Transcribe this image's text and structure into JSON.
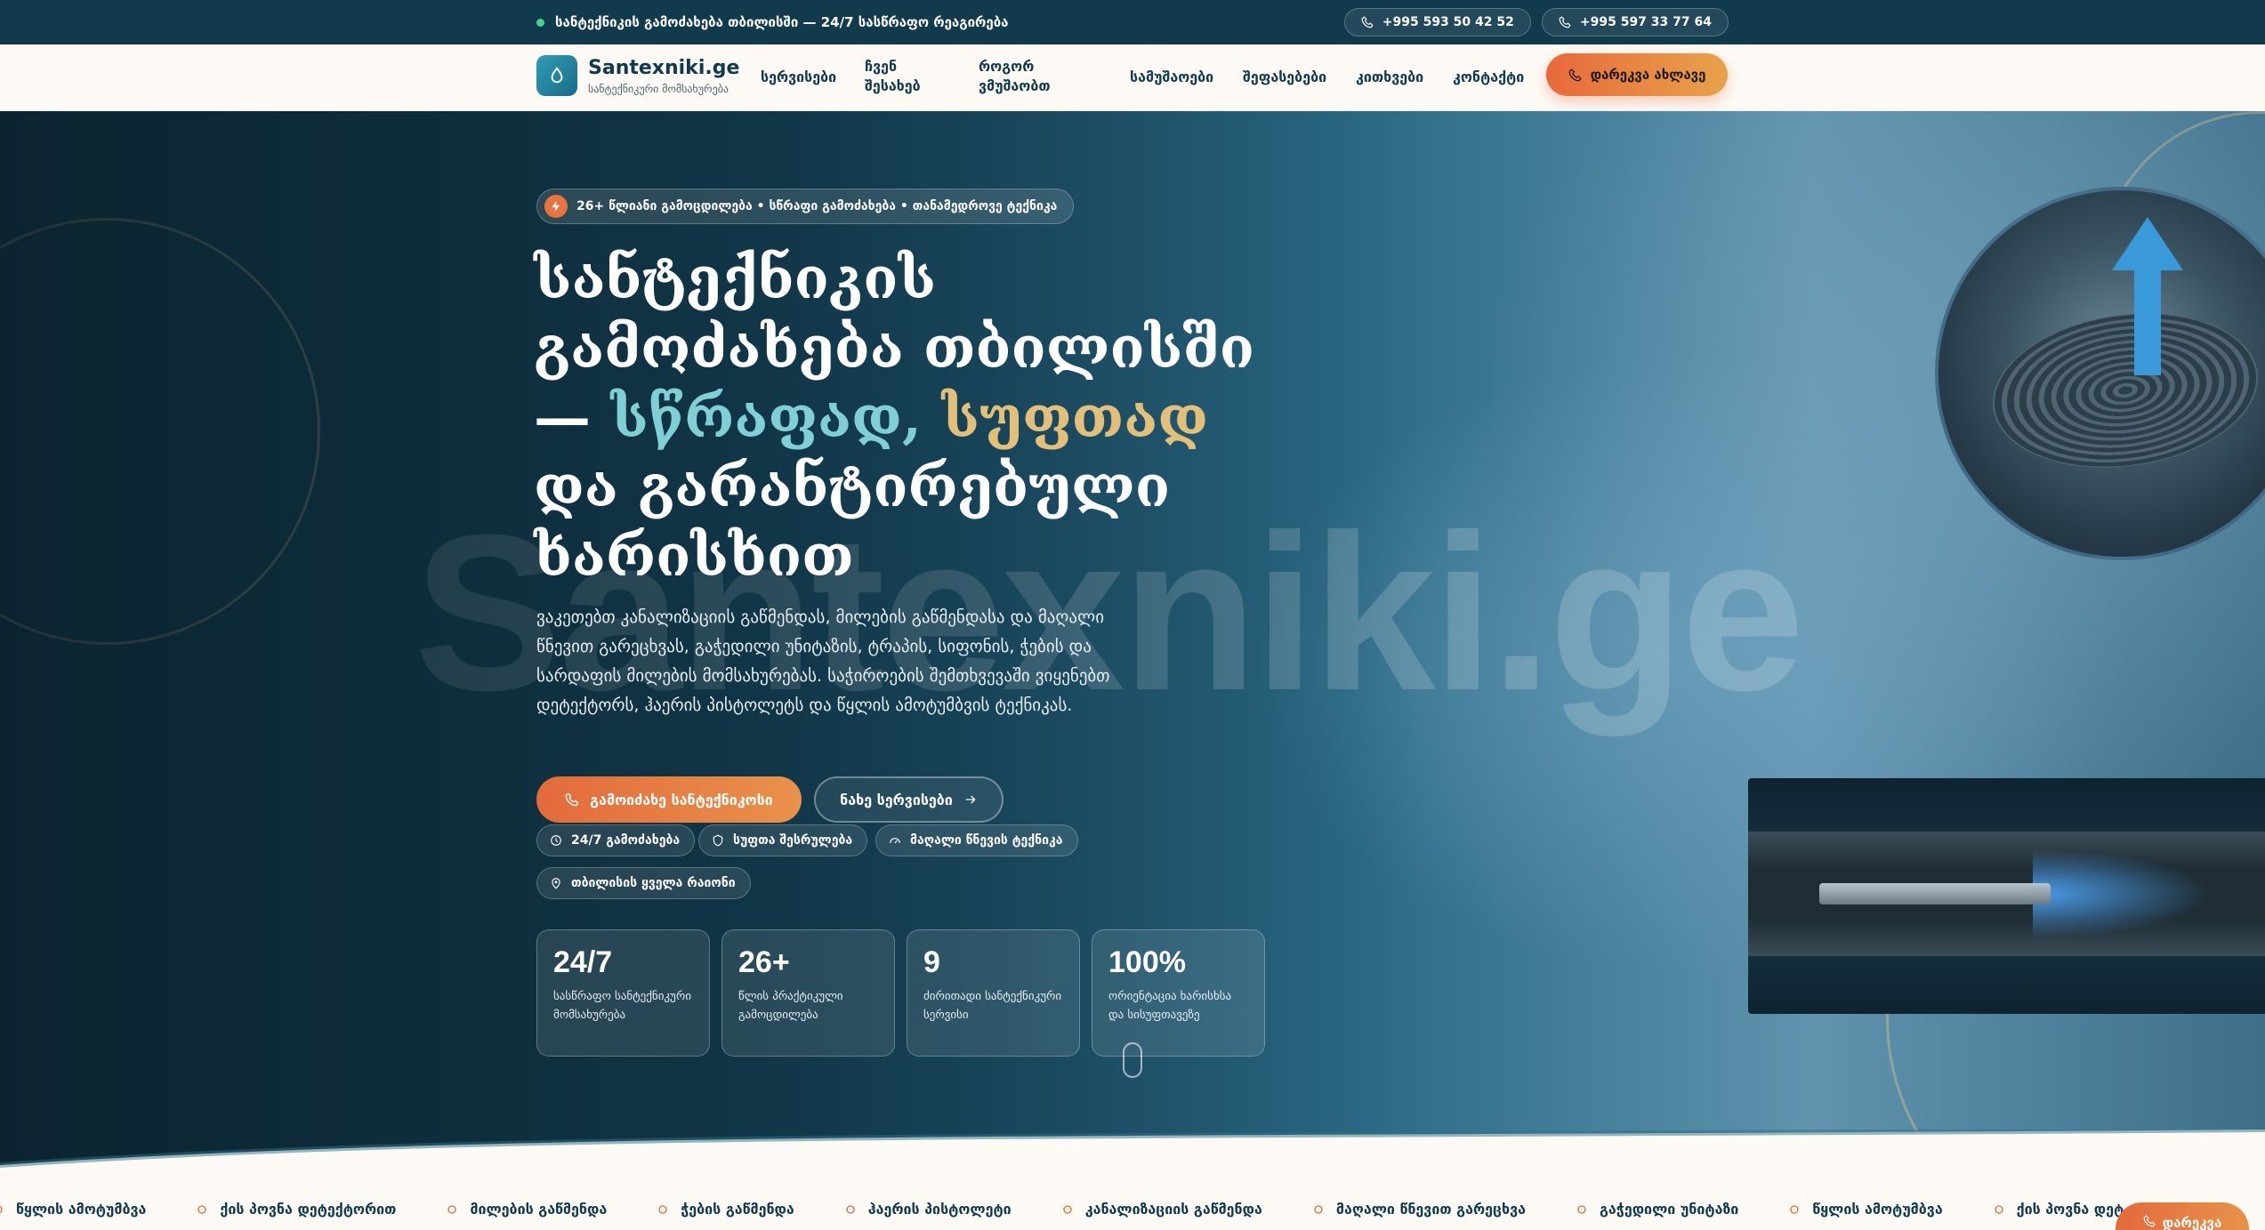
{
  "topbar": {
    "notice": "სანტექნიკის გამოძახება თბილისში — 24/7 სასწრაფო რეაგირება",
    "phones": [
      "+995 593 50 42 52",
      "+995 597 33 77 64"
    ]
  },
  "header": {
    "brand": "Santexniki.ge",
    "brand_sub": "სანტექნიკური მომსახურება",
    "nav": {
      "services": "სერვისები",
      "about": "ჩვენ შესახებ",
      "how": "როგორ ვმუშაობთ",
      "works": "სამუშაოები",
      "prices": "შეფასებები",
      "faq": "კითხვები",
      "contact": "კონტაქტი"
    },
    "call_label": "დარეკვა ახლავე"
  },
  "hero": {
    "badge": "26+ წლიანი გამოცდილება • სწრაფი გამოძახება • თანამედროვე ტექნიკა",
    "title_part1": "სანტექნიკის გამოძახება თბილისში — ",
    "title_fast": "სწრაფად,",
    "title_clean": "სუფთად",
    "title_part2": " და გარანტირებული ხარისხით",
    "description": "ვაკეთებთ კანალიზაციის გაწმენდას, მილების გაწმენდასა და მაღალი წნევით გარეცხვას, გაჭედილი უნიტაზის, ტრაპის, სიფონის, ჭების და სარდაფის მილების მომსახურებას. საჭიროების შემთხვევაში ვიყენებთ დეტექტორს, ჰაერის პისტოლეტს და წყლის ამოტუმბვის ტექნიკას.",
    "primary_btn": "გამოიძახე სანტექნიკოსი",
    "secondary_btn": "ნახე სერვისები",
    "chips": [
      "24/7 გამოძახება",
      "სუფთა შესრულება",
      "მაღალი წნევის ტექნიკა",
      "თბილისის ყველა რაიონი"
    ],
    "watermark": "Santexniki.ge",
    "stats": [
      {
        "num": "24/7",
        "label": "სასწრაფო სანტექნიკური მომსახურება"
      },
      {
        "num": "26+",
        "label": "წლის პრაქტიკული გამოცდილება"
      },
      {
        "num": "9",
        "label": "ძირითადი სანტექნიკური სერვისი"
      },
      {
        "num": "100%",
        "label": "ორიენტაცია ხარისხსა და სისუფთავეზე"
      }
    ]
  },
  "marquee": [
    "წყლის ამოტუმბვა",
    "ქის პოვნა დეტექტორით",
    "მილების გაწმენდა",
    "ჭების გაწმენდა",
    "ჰაერის პისტოლეტი",
    "კანალიზაციის გაწმენდა",
    "მაღალი წნევით გარეცხვა",
    "გაჭედილი უნიტაზი",
    "წყლის ამოტუმბვა",
    "ქის პოვნა დეტ"
  ],
  "float_btn": "დარეკვა",
  "colors": {
    "accent": "#e36a3c",
    "dark": "#113a4c",
    "teal": "#7fcfd4",
    "gold": "#e2c07a"
  }
}
